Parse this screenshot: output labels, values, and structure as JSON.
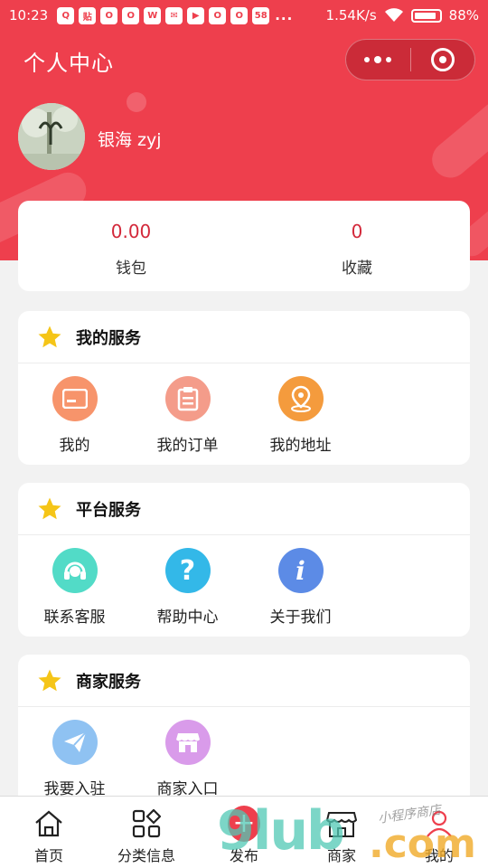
{
  "statusbar": {
    "time": "10:23",
    "app_icons": [
      "Q",
      "贴",
      "O",
      "O",
      "W",
      "✉",
      "▶",
      "O",
      "O",
      "58"
    ],
    "more": "...",
    "network_speed": "1.54K/s",
    "battery_percent": "88%"
  },
  "header": {
    "title": "个人中心",
    "username": "银海 zyj"
  },
  "stats": [
    {
      "value": "0.00",
      "label": "钱包"
    },
    {
      "value": "0",
      "label": "收藏"
    }
  ],
  "sections": [
    {
      "title": "我的服务",
      "items": [
        {
          "label": "我的",
          "icon": "card-icon",
          "color": "#f7946b"
        },
        {
          "label": "我的订单",
          "icon": "clipboard-icon",
          "color": "#f49c8a"
        },
        {
          "label": "我的地址",
          "icon": "location-icon",
          "color": "#f49b3d"
        }
      ]
    },
    {
      "title": "平台服务",
      "items": [
        {
          "label": "联系客服",
          "icon": "headset-icon",
          "color": "#52dbc7"
        },
        {
          "label": "帮助中心",
          "icon": "question-icon",
          "color": "#33b8e8"
        },
        {
          "label": "关于我们",
          "icon": "info-icon",
          "color": "#5c8be6"
        }
      ]
    },
    {
      "title": "商家服务",
      "items": [
        {
          "label": "我要入驻",
          "icon": "paper-plane-icon",
          "color": "#8fc2f2"
        },
        {
          "label": "商家入口",
          "icon": "store-icon",
          "color": "#d99bea"
        }
      ]
    }
  ],
  "tabbar": [
    {
      "label": "首页",
      "icon": "home-icon"
    },
    {
      "label": "分类信息",
      "icon": "category-icon"
    },
    {
      "label": "发布",
      "icon": "add-icon"
    },
    {
      "label": "商家",
      "icon": "shop-icon"
    },
    {
      "label": "我的",
      "icon": "user-icon"
    }
  ],
  "watermark": {
    "brand": "9lub",
    "domain": ".com",
    "signature": "小程序商店"
  },
  "colors": {
    "brand_red": "#ee3f4d",
    "stat_red": "#d3283a",
    "star_yellow": "#f5c518"
  }
}
